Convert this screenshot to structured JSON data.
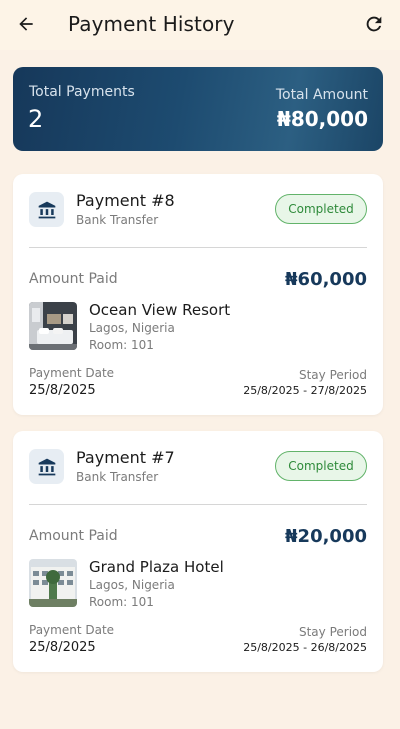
{
  "header": {
    "title": "Payment History",
    "back_icon": "arrow-left-icon",
    "refresh_icon": "refresh-icon"
  },
  "summary": {
    "total_payments_label": "Total Payments",
    "total_payments_value": "2",
    "total_amount_label": "Total Amount",
    "total_amount_value": "₦80,000"
  },
  "payments": [
    {
      "title": "Payment #8",
      "method": "Bank Transfer",
      "status": "Completed",
      "amount_label": "Amount Paid",
      "amount": "₦60,000",
      "hotel_name": "Ocean View Resort",
      "location": "Lagos, Nigeria",
      "room": "Room: 101",
      "payment_date_label": "Payment Date",
      "payment_date": "25/8/2025",
      "stay_period_label": "Stay Period",
      "stay_period": "25/8/2025 - 27/8/2025"
    },
    {
      "title": "Payment #7",
      "method": "Bank Transfer",
      "status": "Completed",
      "amount_label": "Amount Paid",
      "amount": "₦20,000",
      "hotel_name": "Grand Plaza Hotel",
      "location": "Lagos, Nigeria",
      "room": "Room: 101",
      "payment_date_label": "Payment Date",
      "payment_date": "25/8/2025",
      "stay_period_label": "Stay Period",
      "stay_period": "25/8/2025 - 26/8/2025"
    }
  ],
  "colors": {
    "background": "#fbf1e6",
    "summary_gradient_start": "#16385a",
    "summary_gradient_end": "#2c5f82",
    "amount_text": "#17395b",
    "status_green": "#2e8a3a"
  }
}
